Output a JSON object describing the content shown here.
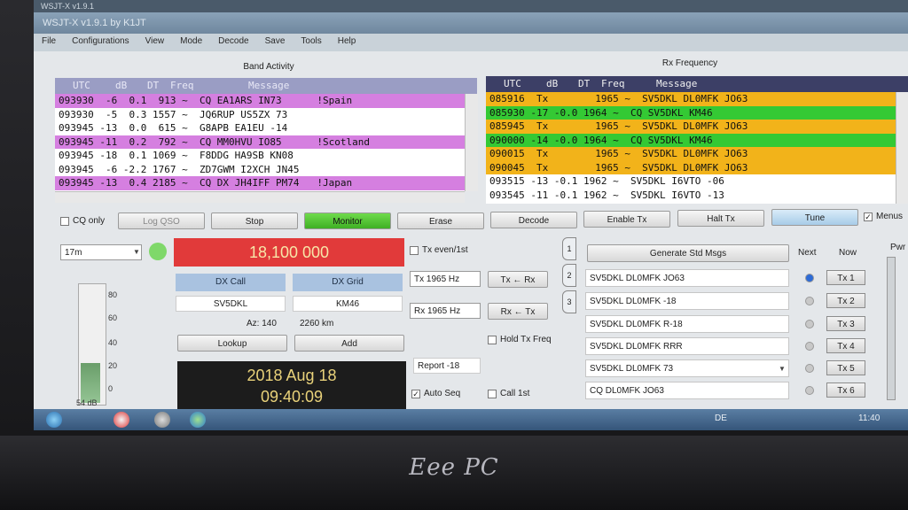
{
  "window": {
    "top_text": "WSJT-X v1.9.1",
    "title": "WSJT-X   v1.9.1   by K1JT"
  },
  "menu": [
    "File",
    "Configurations",
    "View",
    "Mode",
    "Decode",
    "Save",
    "Tools",
    "Help"
  ],
  "band_activity": {
    "title": "Band Activity",
    "headers": [
      "UTC",
      "dB",
      "DT",
      "Freq",
      "Message"
    ],
    "rows": [
      {
        "text": "093930  -6  0.1  913 ~  CQ EA1ARS IN73      !Spain",
        "hl": "#d57fe0"
      },
      {
        "text": "093930  -5  0.3 1557 ~  JQ6RUP US5ZX 73",
        "hl": ""
      },
      {
        "text": "093945 -13  0.0  615 ~  G8APB EA1EU -14",
        "hl": ""
      },
      {
        "text": "093945 -11  0.2  792 ~  CQ MM0HVU IO85      !Scotland",
        "hl": "#d57fe0"
      },
      {
        "text": "093945 -18  0.1 1069 ~  F8DDG HA9SB KN08",
        "hl": ""
      },
      {
        "text": "093945  -6 -2.2 1767 ~  ZD7GWM I2XCH JN45",
        "hl": ""
      },
      {
        "text": "093945 -13  0.4 2185 ~  CQ DX JH4IFF PM74   !Japan",
        "hl": "#d57fe0"
      }
    ]
  },
  "rx_frequency": {
    "title": "Rx Frequency",
    "headers": [
      "UTC",
      "dB",
      "DT",
      "Freq",
      "Message"
    ],
    "rows": [
      {
        "text": "085916  Tx        1965 ~  SV5DKL DL0MFK JO63",
        "hl": "#f2b31a"
      },
      {
        "text": "085930 -17 -0.0 1964 ~  CQ SV5DKL KM46",
        "hl": "#34c934"
      },
      {
        "text": "085945  Tx        1965 ~  SV5DKL DL0MFK JO63",
        "hl": "#f2b31a"
      },
      {
        "text": "090000 -14 -0.0 1964 ~  CQ SV5DKL KM46",
        "hl": "#34c934"
      },
      {
        "text": "090015  Tx        1965 ~  SV5DKL DL0MFK JO63",
        "hl": "#f2b31a"
      },
      {
        "text": "090045  Tx        1965 ~  SV5DKL DL0MFK JO63",
        "hl": "#f2b31a"
      },
      {
        "text": "093515 -13 -0.1 1962 ~  SV5DKL I6VTO -06",
        "hl": ""
      },
      {
        "text": "093545 -11 -0.1 1962 ~  SV5DKL I6VTO -13",
        "hl": ""
      }
    ]
  },
  "controls": {
    "cq_only": "CQ only",
    "log_qso": "Log QSO",
    "stop": "Stop",
    "monitor": "Monitor",
    "erase": "Erase",
    "decode": "Decode",
    "enable_tx": "Enable Tx",
    "halt_tx": "Halt Tx",
    "tune": "Tune",
    "menus": "Menus"
  },
  "band": "17m",
  "frequency": "18,100 000",
  "tx_even": "Tx even/1st",
  "dx_call_label": "DX Call",
  "dx_grid_label": "DX Grid",
  "dx_call": "SV5DKL",
  "dx_grid": "KM46",
  "az": "Az: 140",
  "distance": "2260 km",
  "lookup": "Lookup",
  "add": "Add",
  "tx_freq": "Tx  1965  Hz",
  "rx_freq": "Rx  1965  Hz",
  "tx_from_rx": "Tx ← Rx",
  "rx_from_tx": "Rx ← Tx",
  "hold_tx_freq": "Hold Tx Freq",
  "report": "Report  -18",
  "auto_seq": "Auto Seq",
  "call_1st": "Call 1st",
  "date": "2018 Aug 18",
  "time": "09:40:09",
  "meter": {
    "scale": [
      "80",
      "60",
      "40",
      "20",
      "0"
    ],
    "level_db": "54 dB",
    "level_fraction": 0.33
  },
  "generate": "Generate Std Msgs",
  "next": "Next",
  "now": "Now",
  "pwr": "Pwr",
  "messages": [
    {
      "text": "SV5DKL DL0MFK JO63",
      "btn": "Tx 1",
      "on": true
    },
    {
      "text": "SV5DKL DL0MFK -18",
      "btn": "Tx 2",
      "on": false
    },
    {
      "text": "SV5DKL DL0MFK R-18",
      "btn": "Tx 3",
      "on": false
    },
    {
      "text": "SV5DKL DL0MFK RRR",
      "btn": "Tx 4",
      "on": false
    },
    {
      "text": "SV5DKL DL0MFK 73",
      "btn": "Tx 5",
      "on": false
    },
    {
      "text": "CQ DL0MFK JO63",
      "btn": "Tx 6",
      "on": false
    }
  ],
  "tabs": [
    "1",
    "2",
    "3"
  ],
  "taskbar": {
    "lang": "DE",
    "clock": "11:40"
  },
  "brand": "Eee PC",
  "colors": {
    "cq_highlight": "#d57fe0",
    "tx_row": "#f2b31a",
    "cq_rx": "#34c934",
    "monitor_on": "#3fb024",
    "frequency_bg": "#e13a3a"
  }
}
